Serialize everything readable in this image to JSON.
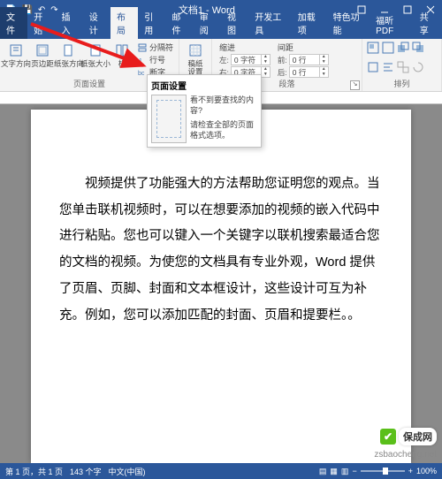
{
  "title": "文档1 - Word",
  "qat": {
    "save": "💾",
    "undo": "↶",
    "redo": "↷"
  },
  "tabs": {
    "file": "文件",
    "items": [
      "开始",
      "插入",
      "设计",
      "布局",
      "引用",
      "邮件",
      "审阅",
      "视图",
      "开发工具",
      "加载项",
      "特色功能",
      "福昕PDF"
    ],
    "active_index": 3,
    "share": "共享"
  },
  "ribbon": {
    "page_setup": {
      "label": "页面设置",
      "margins": "文字方向",
      "orientation": "页边距",
      "size": "纸张方向",
      "columns": "纸张大小",
      "cols": "栏",
      "breaks": "分隔符",
      "line_numbers": "行号",
      "hyphenation": "断字"
    },
    "manuscript": {
      "label": "稿纸",
      "btn": "稿纸\n设置"
    },
    "paragraph": {
      "label": "段落",
      "indent_label": "缩进",
      "spacing_label": "间距",
      "left_label": "左:",
      "right_label": "右:",
      "before_label": "前:",
      "after_label": "后:",
      "left_val": "0 字符",
      "right_val": "0 字符",
      "before_val": "0 行",
      "after_val": "0 行"
    },
    "arrange": {
      "label": "排列"
    }
  },
  "tooltip": {
    "title": "页面设置",
    "line1": "看不到要查找的内容?",
    "line2": "请检查全部的页面格式选项。"
  },
  "document": {
    "p1": "视频提供了功能强大的方法帮助您证明您的观点。当您单击联机视频时，可以在想要添加的视频的嵌入代码中进行粘贴。您也可以键入一个关键字以联机搜索最适合您的文档的视频。为使您的文档具有专业外观，Word 提供了页眉、页脚、封面和文本框设计，这些设计可互为补充。例如，您可以添加匹配的封面、页眉和提要栏。。"
  },
  "status": {
    "page": "第 1 页，共 1 页",
    "words": "143 个字",
    "lang": "中文(中国)",
    "zoom": "100%"
  },
  "watermark": {
    "site": "zsbaocheng.net",
    "brand": "保成网"
  }
}
